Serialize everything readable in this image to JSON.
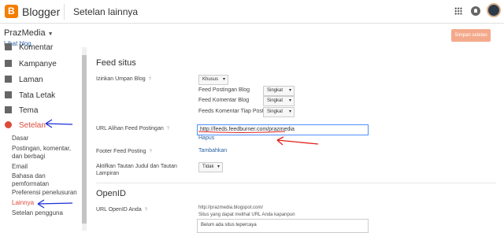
{
  "topbar": {
    "brand": "Blogger",
    "title": "Setelan lainnya"
  },
  "blog": {
    "name": "PrazMedia",
    "view_link": "Lihat blog"
  },
  "save_button": "Simpan setelan",
  "sidebar": {
    "partial_top": "Komentar",
    "items": [
      {
        "label": "Kampanye"
      },
      {
        "label": "Laman"
      },
      {
        "label": "Tata Letak"
      },
      {
        "label": "Tema"
      },
      {
        "label": "Setelan"
      }
    ],
    "subitems": [
      "Dasar",
      "Postingan, komentar, dan berbagi",
      "Email",
      "Bahasa dan pemformatan",
      "Preferensi penelusuran",
      "Lainnya",
      "Setelan pengguna"
    ]
  },
  "feed": {
    "section_title": "Feed situs",
    "allow_label": "Izinkan Umpan Blog",
    "allow_value": "Khusus",
    "rows": [
      {
        "label": "Feed Postingan Blog",
        "value": "Singkat"
      },
      {
        "label": "Feed Komentar Blog",
        "value": "Singkat"
      },
      {
        "label": "Feeds Komentar Tiap Posting",
        "value": "Singkat"
      }
    ],
    "redirect_label": "URL Alihan Feed Postingan",
    "redirect_value": "http://feeds.feedburner.com/prazmedia",
    "delete_link": "Hapus",
    "footer_label": "Footer Feed Posting",
    "footer_link": "Tambahkan",
    "enclosure_label": "Aktifkan Tautan Judul dan Tautan Lampiran",
    "enclosure_value": "Tidak"
  },
  "openid": {
    "section_title": "OpenID",
    "url_label": "URL OpenID Anda",
    "url_value": "http://prazmedia.blogspot.com/",
    "note": "Situs yang dapat melihat URL Anda kapanpun",
    "trusted_text": "Belum ada situs tepercaya"
  },
  "help_glyph": "?",
  "colors": {
    "accent": "#dd4b39",
    "link": "#2962a4",
    "annotation_red": "#e0201a",
    "annotation_blue": "#1a2fd6"
  }
}
